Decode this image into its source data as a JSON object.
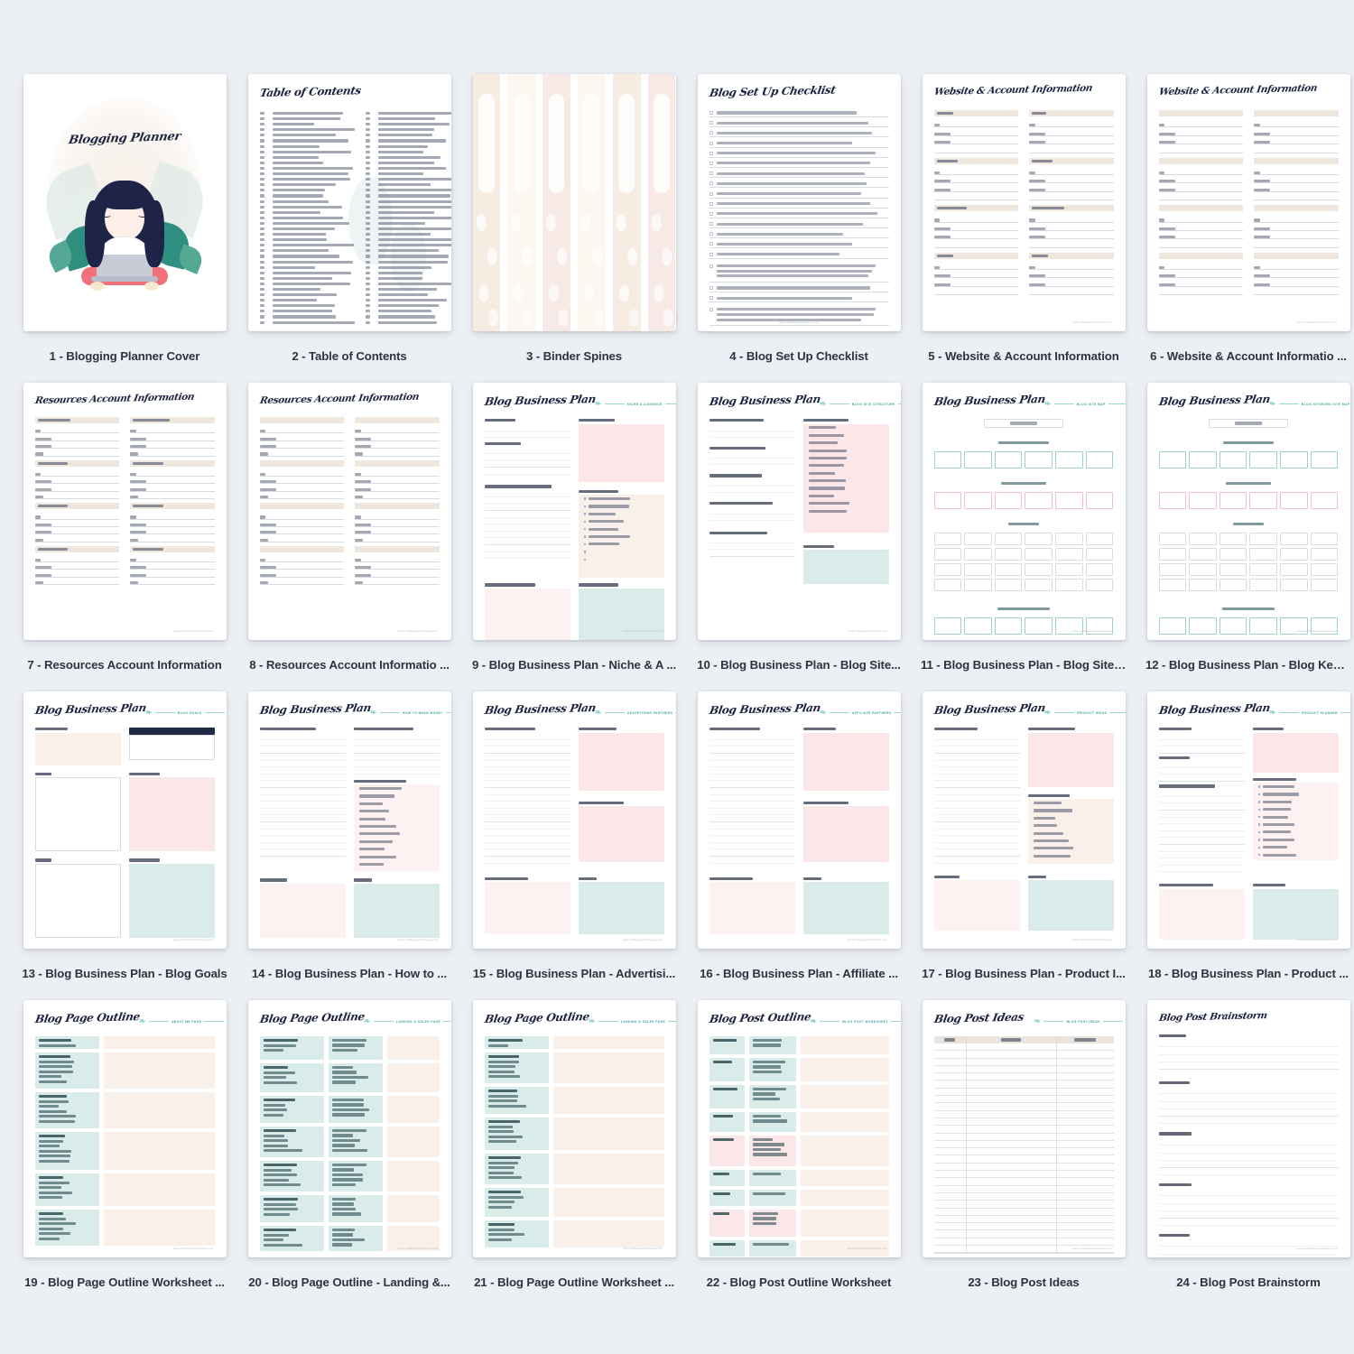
{
  "app": {
    "background_color": "#eceff3",
    "grid": {
      "columns": 6,
      "rows": 4,
      "total_items": 24
    }
  },
  "pages": [
    {
      "n": "1",
      "caption": "1 - Blogging Planner Cover",
      "title": "Blogging Planner",
      "kind": "cover"
    },
    {
      "n": "2",
      "caption": "2 - Table of Contents",
      "title": "Table of Contents",
      "kind": "toc"
    },
    {
      "n": "3",
      "caption": "3 - Binder Spines",
      "title": "",
      "kind": "spines"
    },
    {
      "n": "4",
      "caption": "4 - Blog Set Up Checklist",
      "title": "Blog Set Up Checklist",
      "kind": "checklist"
    },
    {
      "n": "5",
      "caption": "5 - Website & Account Information",
      "title": "Website & Account Information",
      "kind": "accounts",
      "badge": ""
    },
    {
      "n": "6",
      "caption": "6 - Website & Account Informatio ...",
      "title": "Website & Account Information",
      "kind": "accounts-blank",
      "badge": ""
    },
    {
      "n": "7",
      "caption": "7 - Resources Account Information",
      "title": "Resources Account Information",
      "kind": "resources"
    },
    {
      "n": "8",
      "caption": "8 - Resources Account Informatio ...",
      "title": "Resources Account Information",
      "kind": "resources-blank"
    },
    {
      "n": "9",
      "caption": "9 - Blog Business Plan - Niche & A ...",
      "title": "Blog Business Plan",
      "kind": "bp-niche",
      "badge": "Niche & Audience"
    },
    {
      "n": "10",
      "caption": "10 - Blog Business Plan - Blog Site...",
      "title": "Blog Business Plan",
      "kind": "bp-structure",
      "badge": "Blog Site Structure"
    },
    {
      "n": "11",
      "caption": "11 - Blog Business Plan - Blog Site ...",
      "title": "Blog Business Plan",
      "kind": "bp-sitemap",
      "badge": "Blog Site Map"
    },
    {
      "n": "12",
      "caption": "12 - Blog Business Plan - Blog Key ...",
      "title": "Blog Business Plan",
      "kind": "bp-keyword",
      "badge": "Blog Keyword Site Map"
    },
    {
      "n": "13",
      "caption": "13 - Blog Business Plan - Blog Goals",
      "title": "Blog Business Plan",
      "kind": "bp-goals",
      "badge": "Blog Goals"
    },
    {
      "n": "14",
      "caption": "14 - Blog Business Plan - How to  ...",
      "title": "Blog Business Plan",
      "kind": "bp-money",
      "badge": "How to Make Money"
    },
    {
      "n": "15",
      "caption": "15 - Blog Business Plan - Advertisi...",
      "title": "Blog Business Plan",
      "kind": "bp-ads",
      "badge": "Advertising Partners"
    },
    {
      "n": "16",
      "caption": "16 - Blog Business Plan - Affiliate  ...",
      "title": "Blog Business Plan",
      "kind": "bp-affiliate",
      "badge": "Affiliate Partners"
    },
    {
      "n": "17",
      "caption": "17 - Blog Business Plan - Product I...",
      "title": "Blog Business Plan",
      "kind": "bp-product",
      "badge": "Product Ideas"
    },
    {
      "n": "18",
      "caption": "18 - Blog Business Plan - Product  ...",
      "title": "Blog Business Plan",
      "kind": "bp-planner",
      "badge": "Product Planner"
    },
    {
      "n": "19",
      "caption": "19 - Blog Page Outline Worksheet ...",
      "title": "Blog Page Outline",
      "kind": "outline-about",
      "badge": "About Me Page"
    },
    {
      "n": "20",
      "caption": "20 - Blog Page Outline - Landing &...",
      "title": "Blog Page Outline",
      "kind": "outline-landing2",
      "badge": "Landing & Sales Page"
    },
    {
      "n": "21",
      "caption": "21 - Blog Page Outline Worksheet  ...",
      "title": "Blog Page Outline",
      "kind": "outline-landing",
      "badge": "Landing & Sales Page"
    },
    {
      "n": "22",
      "caption": "22 - Blog Post Outline Worksheet",
      "title": "Blog Post Outline",
      "kind": "post-outline",
      "badge": "Blog Post Worksheet"
    },
    {
      "n": "23",
      "caption": "23 - Blog Post Ideas",
      "title": "Blog Post Ideas",
      "kind": "ideas-table",
      "badge": "Blog Post Ideas"
    },
    {
      "n": "24",
      "caption": "24 - Blog Post Brainstorm",
      "title": "Blog Post Brainstorm",
      "kind": "brainstorm"
    }
  ],
  "account_sections": [
    "WEBSITE",
    "HOST",
    "INSTAGRAM",
    "PINTEREST",
    "FACEBOOK PAGE",
    "FACEBOOK GROUP",
    "TWITTER",
    "YOUTUBE"
  ],
  "account_fields": [
    "URL",
    "USERNAME",
    "PASSWORD"
  ],
  "resource_sections": [
    "EMAIL MARKETING",
    "STOCK PHOTOGRAPHY",
    "SERVICE/COURSE",
    "SERVICE/COURSE",
    "SERVICE/COURSE",
    "SERVICE/COURSE",
    "SERVICE/COURSE",
    "SERVICE/COURSE"
  ],
  "resource_fields": [
    "URL",
    "USERNAME",
    "PASSWORD",
    "COST"
  ],
  "theme": {
    "pink": "#fbe7e8",
    "cream": "#f9f0e9",
    "teal": "#d9ecea",
    "beige_header": "#efe6dd",
    "script_navy": "#1c2340",
    "accent_teal": "#3fa39c",
    "caption_color": "#2d3340",
    "card_white": "#ffffff"
  },
  "footer_url": "www.rufflesandrainboots.com"
}
